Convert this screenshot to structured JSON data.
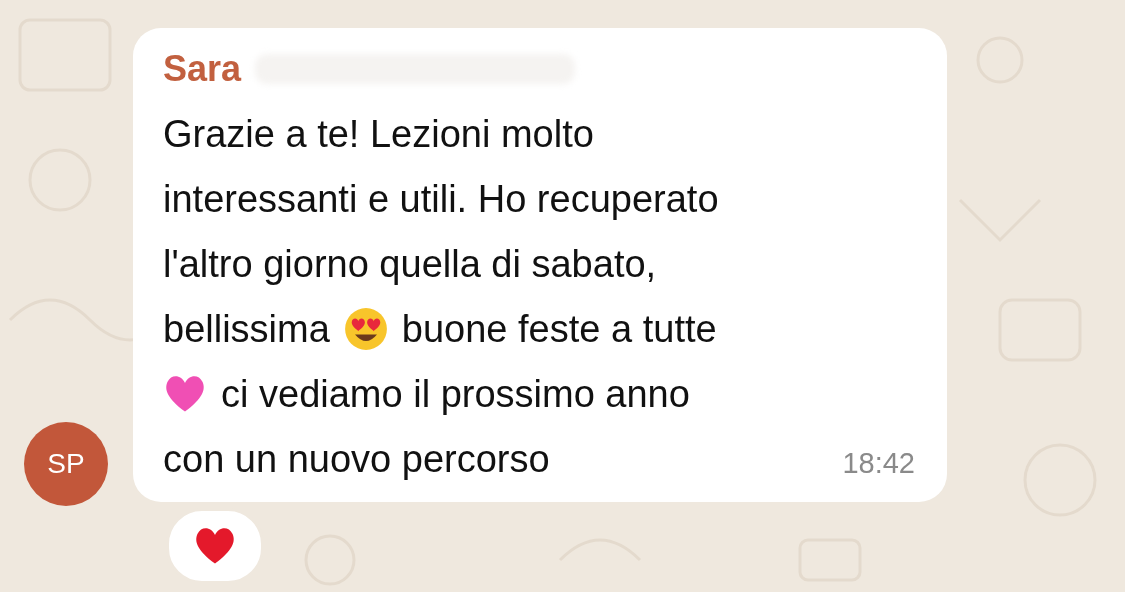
{
  "message": {
    "sender": "Sara",
    "avatar_initials": "SP",
    "time": "18:42",
    "lines": [
      [
        {
          "kind": "text",
          "text": "Grazie a te! Lezioni molto"
        }
      ],
      [
        {
          "kind": "text",
          "text": "interessanti e utili. Ho recuperato"
        }
      ],
      [
        {
          "kind": "text",
          "text": "l'altro giorno quella di sabato,"
        }
      ],
      [
        {
          "kind": "text",
          "text": "bellissima"
        },
        {
          "kind": "face"
        },
        {
          "kind": "text",
          "text": "buone feste a tutte"
        }
      ],
      [
        {
          "kind": "heart"
        },
        {
          "kind": "text",
          "text": "ci vediamo il prossimo anno"
        }
      ],
      [
        {
          "kind": "text",
          "text": "con un nuovo percorso"
        }
      ]
    ]
  }
}
